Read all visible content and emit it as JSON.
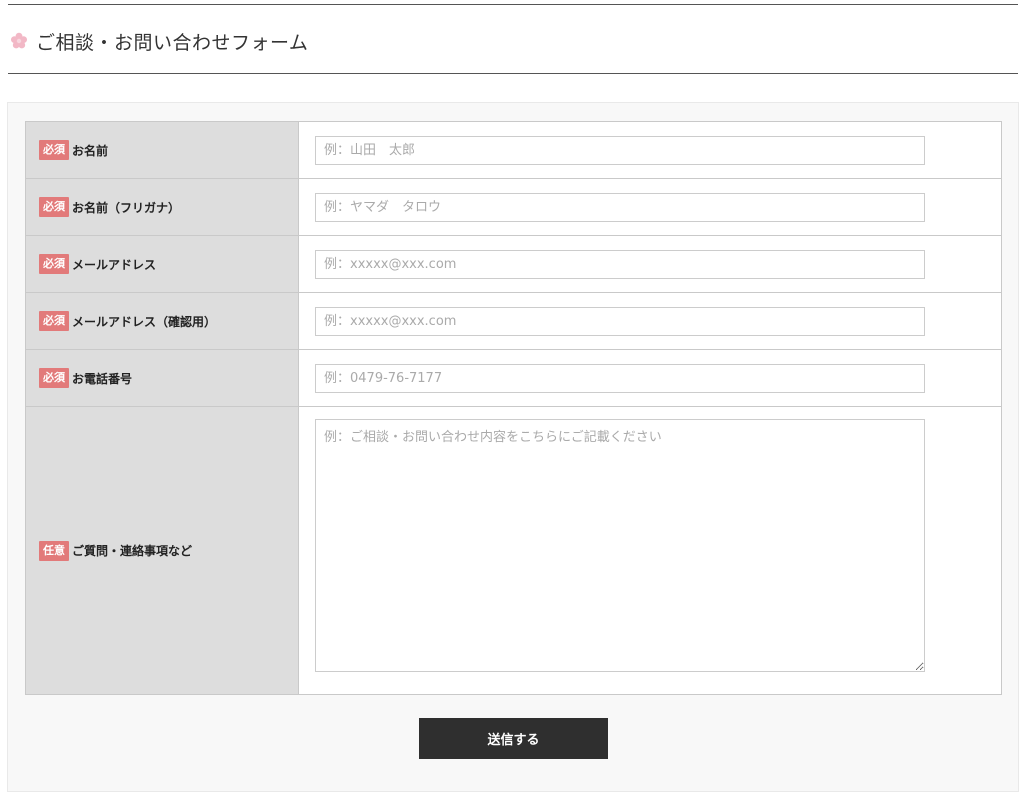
{
  "page": {
    "title": "ご相談・お問い合わせフォーム",
    "title_icon": "cherry-blossom-icon",
    "colors": {
      "badge": "#e27a7a",
      "label_bg": "#dddddd",
      "submit_bg": "#2f2f2f",
      "panel_bg": "#f8f8f8"
    }
  },
  "form": {
    "fields": [
      {
        "badge": "必須",
        "label": "お名前",
        "placeholder": "例：山田　太郎",
        "value": ""
      },
      {
        "badge": "必須",
        "label": "お名前（フリガナ）",
        "placeholder": "例：ヤマダ　タロウ",
        "value": ""
      },
      {
        "badge": "必須",
        "label": "メールアドレス",
        "placeholder": "例：xxxxx@xxx.com",
        "value": ""
      },
      {
        "badge": "必須",
        "label": "メールアドレス（確認用）",
        "placeholder": "例：xxxxx@xxx.com",
        "value": ""
      },
      {
        "badge": "必須",
        "label": "お電話番号",
        "placeholder": "例：0479-76-7177",
        "value": ""
      },
      {
        "badge": "任意",
        "label": "ご質問・連絡事項など",
        "placeholder": "例：ご相談・お問い合わせ内容をこちらにご記載ください",
        "value": ""
      }
    ],
    "submit_label": "送信する"
  }
}
